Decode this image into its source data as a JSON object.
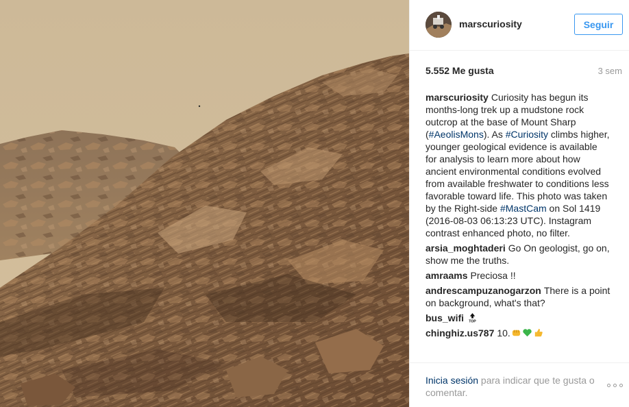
{
  "post": {
    "image_alt": "Mars mudstone outcrop at the base of Mount Sharp"
  },
  "header": {
    "username": "marscuriosity",
    "follow_label": "Seguir"
  },
  "stats": {
    "likes": "5.552 Me gusta",
    "time_ago": "3 sem"
  },
  "caption": {
    "user": "marscuriosity",
    "text_1": "Curiosity has begun its months-long trek up a mudstone rock outcrop at the base of Mount Sharp (",
    "tag_1": "#AeolisMons",
    "text_2": "). As ",
    "tag_2": "#Curiosity",
    "text_3": " climbs higher, younger geological evidence is available for analysis to learn more about how ancient environmental conditions evolved from available freshwater to conditions less favorable toward life. This photo was taken by the Right-side ",
    "tag_3": "#MastCam",
    "text_4": " on Sol 1419 (2016-08-03 06:13:23 UTC). Instagram contrast enhanced photo, no filter."
  },
  "comments": [
    {
      "user": "arsia_moghtaderi",
      "text": "Go On geologist, go on, show me the truths."
    },
    {
      "user": "amraams",
      "text": "Preciosa !!"
    },
    {
      "user": "andrescampuzanogarzon",
      "text": "There is a point on background, what's that?"
    },
    {
      "user": "bus_wifi",
      "text": "",
      "icon": "top-arrow-icon"
    },
    {
      "user": "chinghiz.us787",
      "text": "10.",
      "icons": [
        "fist-emoji-icon",
        "green-heart-emoji-icon",
        "thumbs-up-emoji-icon"
      ]
    }
  ],
  "footer": {
    "login_link": "Inicia sesión",
    "login_rest": " para indicar que te gusta o comentar.",
    "more_icon": "more-options-icon"
  },
  "colors": {
    "link": "#003569",
    "accent": "#3897f0",
    "muted": "#999999"
  }
}
